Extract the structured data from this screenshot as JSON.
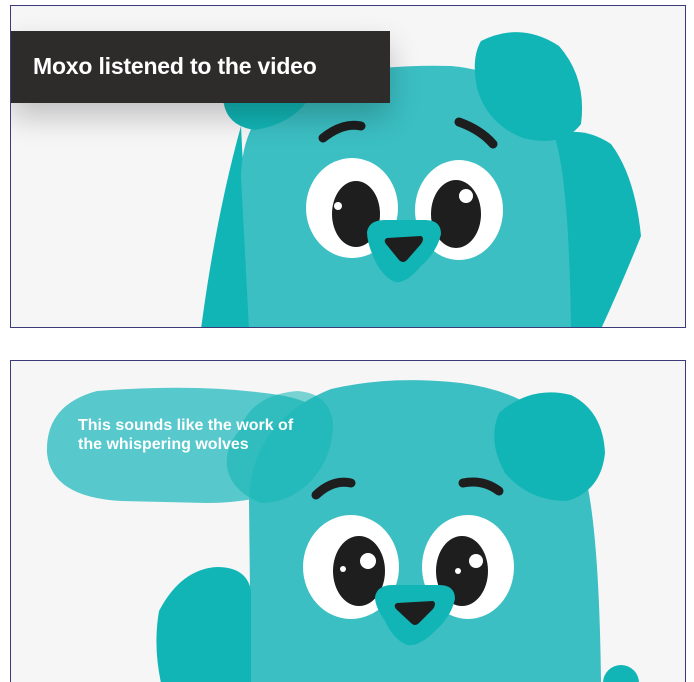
{
  "panel_top": {
    "caption": "Moxo listened to the video"
  },
  "panel_bottom": {
    "speech_bubble": "This sounds like the work of the whispering wolves"
  },
  "colors": {
    "character_body": "#3bbfc3",
    "character_dark": "#12b5b5",
    "background": "#f6f6f7",
    "caption_background": "#2e2b2b",
    "bubble": "#5ccbd0",
    "frame_border": "#3c3a78"
  }
}
